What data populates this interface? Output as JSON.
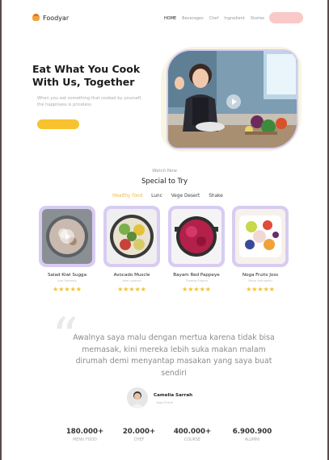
{
  "brand": {
    "name": "Foodyar",
    "icon": "food-bowl-icon"
  },
  "nav": {
    "links": [
      "HOME",
      "Beverages",
      "Chef",
      "Ingredient",
      "Stories"
    ],
    "active": "HOME"
  },
  "hero": {
    "title": "Eat What You Cook With Us, Together",
    "subtitle": "When you eat something that cooked by yourself, the happiness is priceless"
  },
  "section": {
    "eyebrow": "Watch Now",
    "title": "Special to Try",
    "tabs": [
      "Healthy food",
      "Lunc",
      "Vege Desert",
      "Shake"
    ],
    "active_tab": "Healthy food"
  },
  "cards": [
    {
      "name": "Salad Kiwi Sugga",
      "sub": "Aria Sorrenty",
      "stars": "★★★★★"
    },
    {
      "name": "Avocado Muscle",
      "sub": "John Lorenzo",
      "stars": "★★★★★"
    },
    {
      "name": "Bayam Red Pappeye",
      "sub": "Thomas Engine",
      "stars": "★★★★★"
    },
    {
      "name": "Noga Fruits Joss",
      "sub": "Nisha Safrudeen",
      "stars": "★★★★★"
    }
  ],
  "testimonial": {
    "text": "Awalnya saya malu dengan  mertua karena tidak bisa memasak, kini mereka lebih suka makan malam dirumah  demi menyantap masakan yang saya buat sendiri",
    "author": "Camelia  Sarrah",
    "role": "Yoga Pratik"
  },
  "stats": [
    {
      "value": "180.000+",
      "label": "MENU FOOD"
    },
    {
      "value": "20.000+",
      "label": "CHEF"
    },
    {
      "value": "400.000+",
      "label": "COURSE"
    },
    {
      "value": "6.900.900",
      "label": "ALUMNI"
    }
  ],
  "colors": {
    "accent": "#f7c22e",
    "card_frame": "#d8ccf2",
    "nav_button": "#f9c9c8",
    "star": "#f3c12d"
  }
}
